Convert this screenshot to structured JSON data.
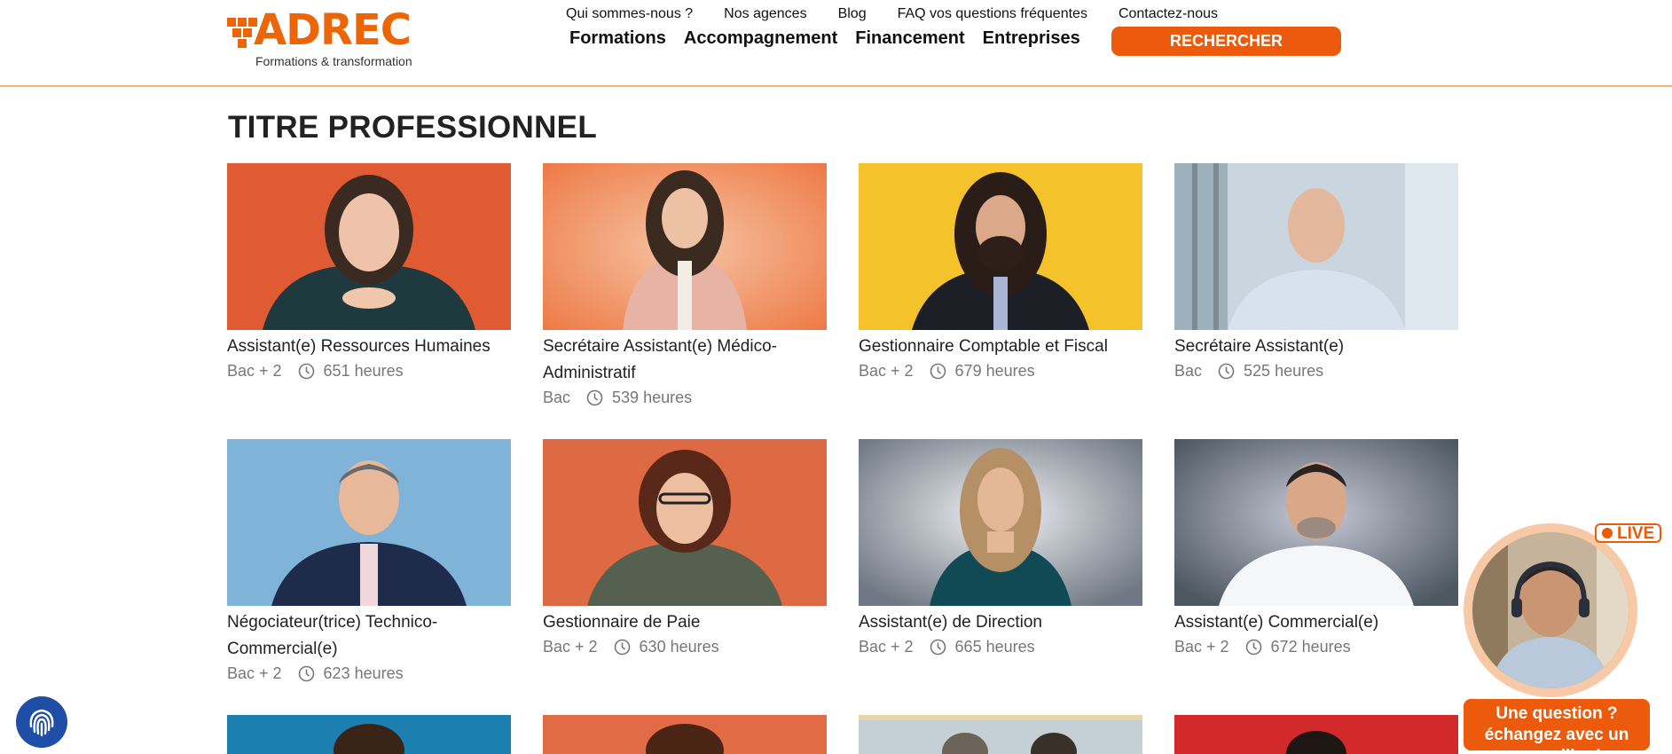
{
  "header": {
    "logo_text": "ADREC",
    "logo_tagline": "Formations & transformation",
    "top_links": [
      "Qui sommes-nous ?",
      "Nos agences",
      "Blog",
      "FAQ vos questions fréquentes",
      "Contactez-nous"
    ],
    "main_links": [
      "Formations",
      "Accompagnement",
      "Financement",
      "Entreprises"
    ],
    "search_label": "RECHERCHER"
  },
  "main": {
    "title": "TITRE PROFESSIONNEL",
    "cards": [
      {
        "title": "Assistant(e) Ressources Humaines",
        "level": "Bac + 2",
        "hours": "651 heures"
      },
      {
        "title": "Secrétaire Assistant(e) Médico-Administratif",
        "level": "Bac",
        "hours": "539 heures"
      },
      {
        "title": "Gestionnaire Comptable et Fiscal",
        "level": "Bac + 2",
        "hours": "679 heures"
      },
      {
        "title": "Secrétaire Assistant(e)",
        "level": "Bac",
        "hours": "525 heures"
      },
      {
        "title": "Négociateur(trice) Technico-Commercial(e)",
        "level": "Bac + 2",
        "hours": "623 heures"
      },
      {
        "title": "Gestionnaire de Paie",
        "level": "Bac + 2",
        "hours": "630 heures"
      },
      {
        "title": "Assistant(e) de Direction",
        "level": "Bac + 2",
        "hours": "665 heures"
      },
      {
        "title": "Assistant(e) Commercial(e)",
        "level": "Bac + 2",
        "hours": "672 heures"
      }
    ]
  },
  "live_widget": {
    "badge": "LIVE",
    "caption": "Une question ? échangez avec un conseiller !"
  },
  "colors": {
    "brand": "#ec6608",
    "button": "#ec5a0b",
    "header_border": "#f0b37a",
    "fingerprint_button": "#1f4ea6"
  },
  "icons": [
    "clock-icon",
    "fingerprint-icon",
    "live-dot-icon"
  ]
}
